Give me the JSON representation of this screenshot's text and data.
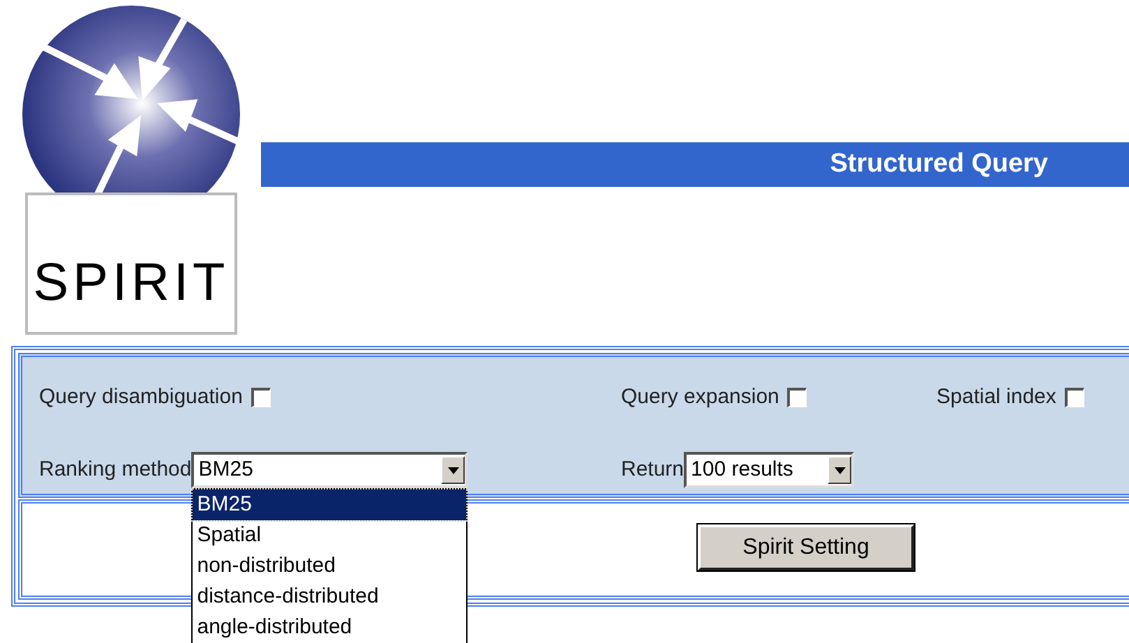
{
  "logo": {
    "text": "SPIRIT"
  },
  "header": {
    "title": "Structured Query"
  },
  "options": [
    {
      "label": "Query disambiguation",
      "checked": false
    },
    {
      "label": "Query expansion",
      "checked": false
    },
    {
      "label": "Spatial index",
      "checked": false
    }
  ],
  "ranking": {
    "label": "Ranking method",
    "value": "BM25",
    "expanded": true,
    "options": [
      {
        "label": "BM25",
        "selected": true
      },
      {
        "label": "Spatial",
        "selected": false
      },
      {
        "label": "non-distributed",
        "selected": false
      },
      {
        "label": "distance-distributed",
        "selected": false
      },
      {
        "label": "angle-distributed",
        "selected": false
      }
    ]
  },
  "return": {
    "label": "Return",
    "value": "100 results"
  },
  "button": {
    "label": "Spirit Setting"
  }
}
